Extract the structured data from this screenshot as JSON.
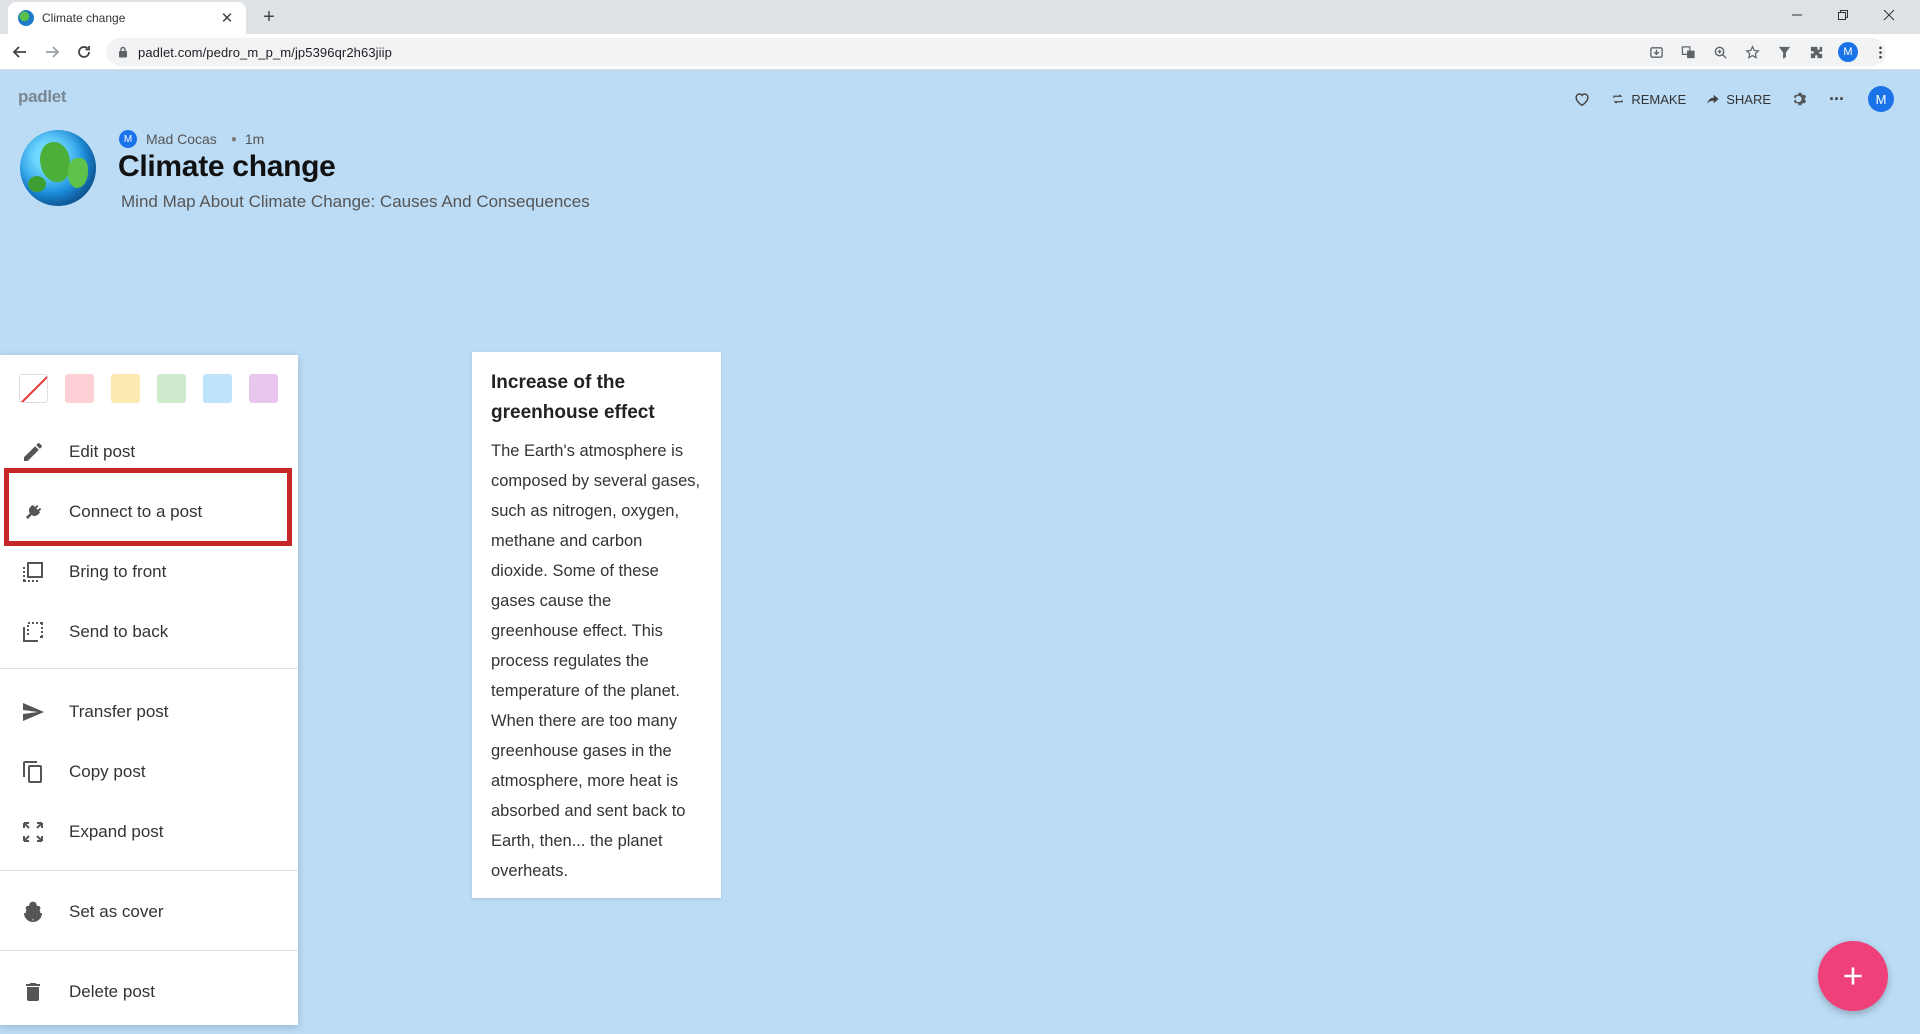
{
  "browser": {
    "tab_title": "Climate change",
    "tab_close": "✕",
    "new_tab": "+",
    "url": "padlet.com/pedro_m_p_m/jp5396qr2h63jiip",
    "profile_initial": "M"
  },
  "header": {
    "logo": "padlet",
    "remake_label": "REMAKE",
    "share_label": "SHARE",
    "more_label": "···",
    "avatar_initial": "M"
  },
  "board": {
    "author_initial": "M",
    "author": "Mad Cocas",
    "time_ago": "1m",
    "title": "Climate change",
    "subtitle": "Mind Map About Climate Change: Causes And Consequences"
  },
  "menu": {
    "swatch_colors": [
      "none",
      "#fdd0d6",
      "#fdeab0",
      "#cdeacc",
      "#bfe3f9",
      "#e8c6ee"
    ],
    "items": [
      {
        "label": "Edit post",
        "icon": "pencil-icon"
      },
      {
        "label": "Connect to a post",
        "icon": "plug-icon"
      },
      {
        "label": "Bring to front",
        "icon": "bring-to-front-icon"
      },
      {
        "label": "Send to back",
        "icon": "send-to-back-icon"
      },
      {
        "label": "Transfer post",
        "icon": "send-icon"
      },
      {
        "label": "Copy post",
        "icon": "copy-icon"
      },
      {
        "label": "Expand post",
        "icon": "expand-icon"
      },
      {
        "label": "Set as cover",
        "icon": "flower-icon"
      },
      {
        "label": "Delete post",
        "icon": "trash-icon"
      }
    ],
    "highlight_color": "#c62828"
  },
  "post": {
    "title": "Increase of the greenhouse effect",
    "body": "The Earth's atmosphere is composed by several gases, such as nitrogen, oxygen, methane and carbon dioxide. Some of these gases cause the greenhouse effect. This process regulates the temperature of the planet. When there are too many greenhouse gases in the atmosphere, more heat is absorbed and sent back to Earth, then... the planet overheats."
  },
  "colors": {
    "board_background": "#bcdcf6",
    "fab": "#f0407a",
    "accent": "#1a73e8"
  }
}
